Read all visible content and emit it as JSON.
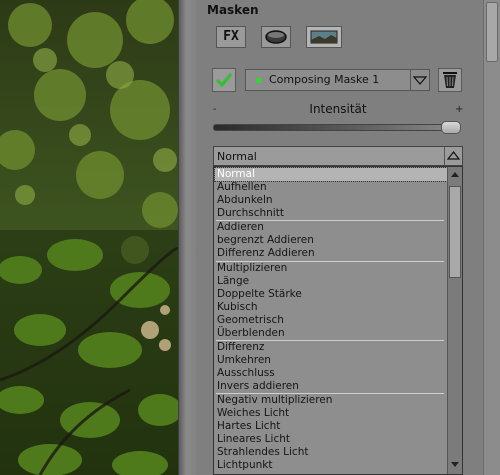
{
  "panel": {
    "title": "Masken",
    "fx_label": "FX",
    "mask_name": "Composing Maske 1",
    "mask_active_color": "#33d633",
    "intensity_label": "Intensität",
    "intensity_minus": "-",
    "intensity_plus": "+",
    "intensity_value": 1.0,
    "blend_mode": "Normal"
  },
  "dropdown_items": [
    "Normal",
    "Aufhellen",
    "Abdunkeln",
    "Durchschnitt",
    "Addieren",
    "begrenzt Addieren",
    "Differenz Addieren",
    "Multiplizieren",
    "Länge",
    "Doppelte Stärke",
    "Kubisch",
    "Geometrisch",
    "Überblenden",
    "Differenz",
    "Umkehren",
    "Ausschluss",
    "Invers addieren",
    "Negativ multiplizieren",
    "Weiches Licht",
    "Hartes Licht",
    "Lineares Licht",
    "Strahlendes Licht",
    "Lichtpunkt"
  ],
  "icons": [
    "fx-icon",
    "circle-mask-icon",
    "landscape-mask-icon",
    "checkmark-icon",
    "chevron-down-icon",
    "trash-icon",
    "chevron-up-icon"
  ]
}
